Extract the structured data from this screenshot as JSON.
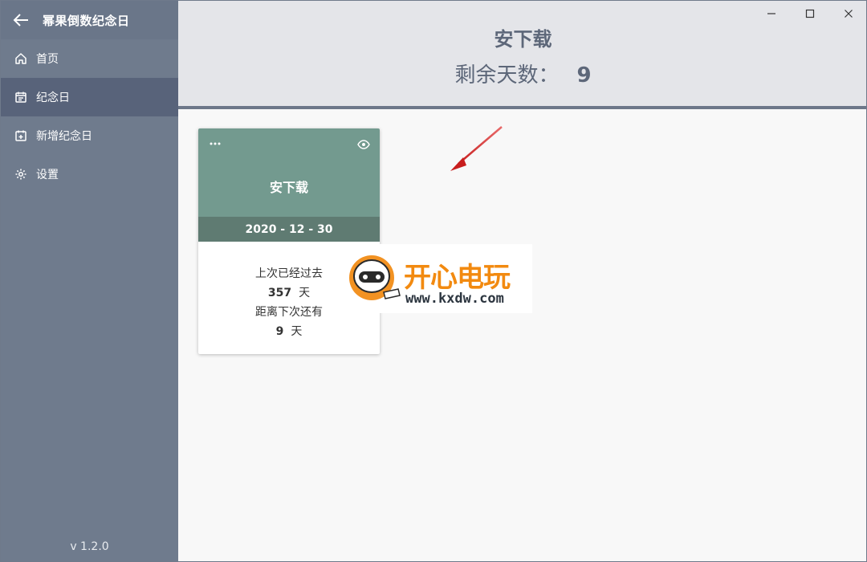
{
  "app": {
    "title": "幂果倒数纪念日",
    "version": "v 1.2.0"
  },
  "sidebar": {
    "items": [
      {
        "label": "首页",
        "icon": "home-icon",
        "active": false
      },
      {
        "label": "纪念日",
        "icon": "calendar-icon",
        "active": true
      },
      {
        "label": "新增纪念日",
        "icon": "calendar-add-icon",
        "active": false
      },
      {
        "label": "设置",
        "icon": "gear-icon",
        "active": false
      }
    ]
  },
  "header": {
    "title": "安下载",
    "remaining_label": "剩余天数：",
    "remaining_value": "9"
  },
  "card": {
    "name": "安下载",
    "date": "2020 - 12 - 30",
    "passed_label": "上次已经过去",
    "passed_value": "357",
    "passed_unit": "天",
    "next_label": "距离下次还有",
    "next_value": "9",
    "next_unit": "天",
    "color": "#739a8f"
  },
  "watermark": {
    "brand": "开心电玩",
    "url": "www.kxdw.com"
  },
  "colors": {
    "sidebar": "#6f7b8d",
    "sidebar_active": "#58637a",
    "header_bg": "#e4e5e9",
    "card_top": "#739a8f",
    "card_date": "#5f7b72",
    "annotation_arrow": "#d22a2a"
  }
}
